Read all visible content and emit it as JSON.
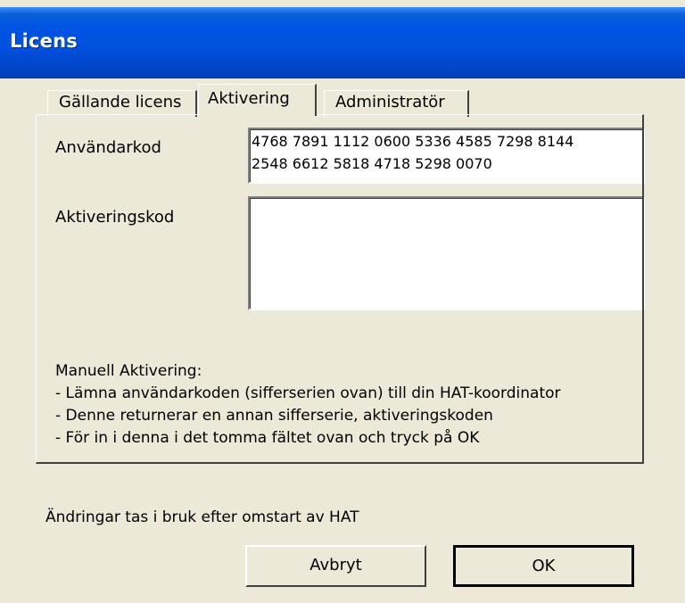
{
  "window": {
    "title": "Licens"
  },
  "tabs": [
    {
      "label": "Gällande licens",
      "active": false
    },
    {
      "label": "Aktivering",
      "active": true
    },
    {
      "label": "Administratör",
      "active": false
    }
  ],
  "activation": {
    "user_code_label": "Användarkod",
    "user_code_lines": [
      "4768 7891 1112 0600 5336 4585 7298 8144",
      "2548 6612 5818 4718 5298 0070"
    ],
    "activation_code_label": "Aktiveringskod",
    "activation_code_value": "",
    "instructions": [
      "Manuell Aktivering:",
      "- Lämna användarkoden (sifferserien ovan) till din HAT-koordinator",
      "- Denne returnerar en annan sifferserie, aktiveringskoden",
      "- För in i denna i det tomma fältet ovan och tryck på OK"
    ]
  },
  "footer_note": "Ändringar tas i bruk efter omstart av HAT",
  "buttons": {
    "cancel": "Avbryt",
    "ok": "OK"
  },
  "colors": {
    "dialog_bg": "#ece9d8",
    "titlebar": "#0054e3",
    "title_text": "#ffffff"
  }
}
